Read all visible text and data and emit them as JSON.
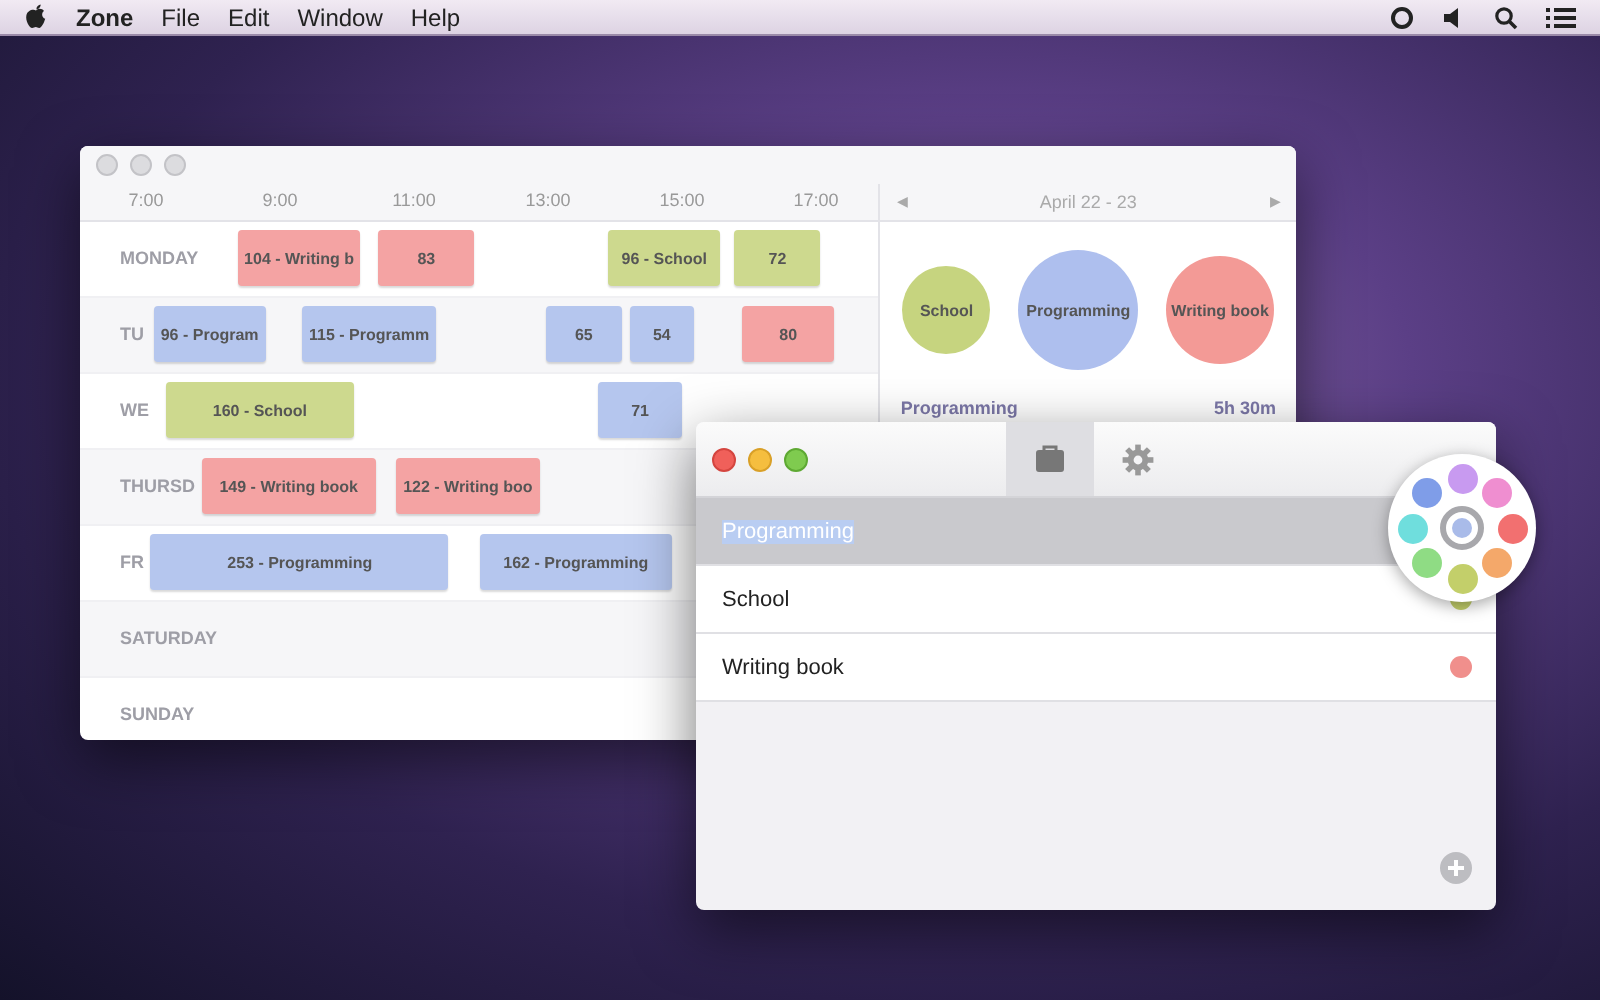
{
  "menu_bar": {
    "app_name": "Zone",
    "items": [
      "File",
      "Edit",
      "Window",
      "Help"
    ]
  },
  "calendar_window": {
    "hours": [
      "7:00",
      "9:00",
      "11:00",
      "13:00",
      "15:00",
      "17:00"
    ],
    "days": [
      {
        "label": "MONDAY",
        "blocks": [
          {
            "label": "104 - Writing b",
            "color": "#f4a3a3"
          },
          {
            "label": "83",
            "color": "#f4a3a3"
          },
          {
            "label": "96 - School",
            "color": "#cdd98e"
          },
          {
            "label": "72",
            "color": "#cdd98e"
          }
        ]
      },
      {
        "label": "TU",
        "blocks": [
          {
            "label": "96 - Program",
            "color": "#b5c6ee"
          },
          {
            "label": "115 - Programm",
            "color": "#b5c6ee"
          },
          {
            "label": "65",
            "color": "#b5c6ee"
          },
          {
            "label": "54",
            "color": "#b5c6ee"
          },
          {
            "label": "80",
            "color": "#f4a3a3"
          }
        ]
      },
      {
        "label": "WE",
        "blocks": [
          {
            "label": "160 - School",
            "color": "#cdd98e"
          },
          {
            "label": "71",
            "color": "#b5c6ee"
          }
        ]
      },
      {
        "label": "THURSD",
        "blocks": [
          {
            "label": "149 - Writing book",
            "color": "#f4a3a3"
          },
          {
            "label": "122 - Writing boo",
            "color": "#f4a3a3"
          }
        ]
      },
      {
        "label": "FR",
        "blocks": [
          {
            "label": "253 - Programming",
            "color": "#b5c6ee"
          },
          {
            "label": "162 - Programming",
            "color": "#b5c6ee"
          }
        ]
      },
      {
        "label": "SATURDAY"
      },
      {
        "label": "SUNDAY"
      }
    ],
    "summary": {
      "prev": "◀",
      "next": "▶",
      "range": "April 22 - 23",
      "bubbles": [
        {
          "label": "School",
          "color": "#c6d47f"
        },
        {
          "label": "Programming",
          "color": "#aebfee"
        },
        {
          "label": "Writing book",
          "color": "#f39a96"
        }
      ],
      "total": {
        "name": "Programming",
        "time": "5h 30m"
      }
    }
  },
  "projects_window": {
    "tabs": [
      {
        "kind": "briefcase",
        "selected": true
      },
      {
        "kind": "gear",
        "selected": false
      }
    ],
    "rows": [
      {
        "name": "Programming",
        "selected": true,
        "editing": true
      },
      {
        "name": "School",
        "selected": false,
        "editing": false,
        "color": "#c3cf6a"
      },
      {
        "name": "Writing book",
        "selected": false,
        "editing": false,
        "color": "#f08f8c"
      }
    ],
    "color_picker": {
      "current": {
        "color": "#a9bbe9"
      },
      "swatches": [
        {
          "color": "#7f9de8"
        },
        {
          "color": "#c89af0"
        },
        {
          "color": "#ef8ed0"
        },
        {
          "color": "#f27070"
        },
        {
          "color": "#f4a86a"
        },
        {
          "color": "#c3cf6a"
        },
        {
          "color": "#8fdc84"
        },
        {
          "color": "#6fdedd"
        }
      ]
    }
  }
}
